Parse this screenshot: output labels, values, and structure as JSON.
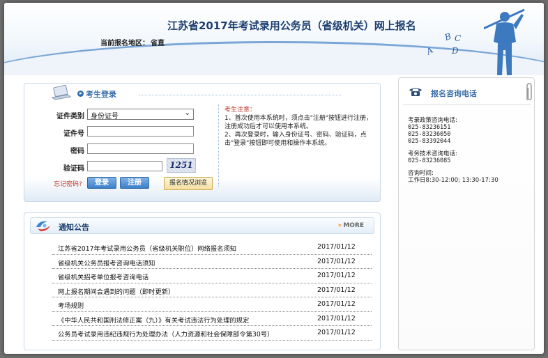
{
  "header": {
    "title": "江苏省2017年考试录用公务员（省级机关）网上报名",
    "region_label": "当前报名地区：",
    "region_value": "省直",
    "decor_letters": [
      "A",
      "B",
      "C",
      "D"
    ]
  },
  "login": {
    "title": "考生登录",
    "fields": {
      "id_type_label": "证件类别",
      "id_type_value": "身份证号",
      "id_number_label": "证件号",
      "password_label": "密码",
      "captcha_label": "验证码",
      "captcha_text": "1251"
    },
    "forgot_password": "忘记密码?",
    "login_button": "登录",
    "register_button": "注册",
    "browse_button": "报名情况浏览",
    "notice": {
      "title": "考生注意：",
      "line1": "1、首次使用本系统时，须点击\"注册\"按钮进行注册，注册成功后才可以使用本系统。",
      "line2": "2、再次登录时，输入身份证号、密码、验证码，点击\"登录\"按钮即可使用和操作本系统。"
    }
  },
  "news": {
    "title": "通知公告",
    "more_label": "MORE",
    "items": [
      {
        "text": "江苏省2017年考试录用公务员（省级机关职位）网络报名须知",
        "date": "2017/01/12"
      },
      {
        "text": "省级机关公务员报考咨询电话须知",
        "date": "2017/01/12"
      },
      {
        "text": "省级机关招考单位报考咨询电话",
        "date": "2017/01/12"
      },
      {
        "text": "网上报名期间会遇到的问题（即时更新）",
        "date": "2017/01/12"
      },
      {
        "text": "考场规则",
        "date": "2017/01/12"
      },
      {
        "text": "《中华人民共和国刑法修正案（九）》有关考试违法行为处理的规定",
        "date": "2017/01/12"
      },
      {
        "text": "公务员考试录用违纪违规行为处理办法（人力资源和社会保障部令第30号）",
        "date": "2017/01/12"
      }
    ]
  },
  "contact": {
    "title": "报名咨询电话",
    "policy_label": "考录政策咨询电话:",
    "policy_phones": [
      "025-83236151",
      "025-83236050",
      "025-83392044"
    ],
    "tech_label": "考务技术咨询电话:",
    "tech_phones": [
      "025-83236085"
    ],
    "hours_label": "咨询时间:",
    "hours_value": "工作日8:30-12:00; 13:30-17:30"
  }
}
